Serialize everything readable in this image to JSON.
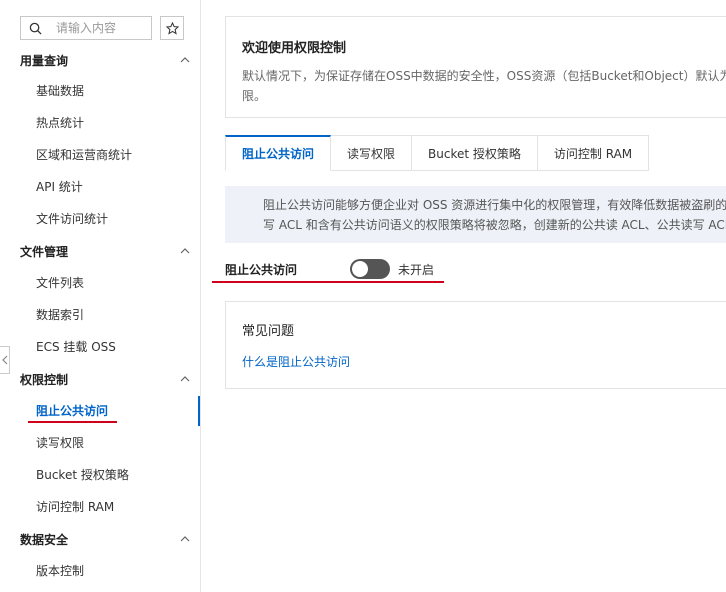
{
  "sidebar": {
    "search_placeholder": "请输入内容",
    "groups": [
      {
        "title": "用量查询",
        "items": [
          "基础数据",
          "热点统计",
          "区域和运营商统计",
          "API 统计",
          "文件访问统计"
        ]
      },
      {
        "title": "文件管理",
        "items": [
          "文件列表",
          "数据索引",
          "ECS 挂载 OSS"
        ]
      },
      {
        "title": "权限控制",
        "items": [
          "阻止公共访问",
          "读写权限",
          "Bucket 授权策略",
          "访问控制 RAM"
        ]
      },
      {
        "title": "数据安全",
        "items": [
          "版本控制"
        ]
      }
    ],
    "active_item": "阻止公共访问"
  },
  "welcome": {
    "title": "欢迎使用权限控制",
    "description_line1": "默认情况下，为保证存储在OSS中数据的安全性，OSS资源（包括Bucket和Object）默认为私",
    "description_line2": "限。"
  },
  "tabs": [
    {
      "label": "阻止公共访问",
      "active": true
    },
    {
      "label": "读写权限",
      "active": false
    },
    {
      "label": "Bucket 授权策略",
      "active": false
    },
    {
      "label": "访问控制 RAM",
      "active": false
    }
  ],
  "info": {
    "line1": "阻止公共访问能够方便企业对 OSS 资源进行集中化的权限管理，有效降低数据被盗刷的风",
    "line2": "写 ACL 和含有公共访问语义的权限策略将被忽略，创建新的公共读 ACL、公共读写 ACL 或"
  },
  "block_public_access": {
    "label": "阻止公共访问",
    "state_text": "未开启",
    "enabled": false
  },
  "faq": {
    "title": "常见问题",
    "link": "什么是阻止公共访问"
  },
  "colors": {
    "accent": "#0064c8",
    "annotation_red": "#d0021b",
    "switch_off": "#555555",
    "info_bg": "#eef2f8"
  }
}
